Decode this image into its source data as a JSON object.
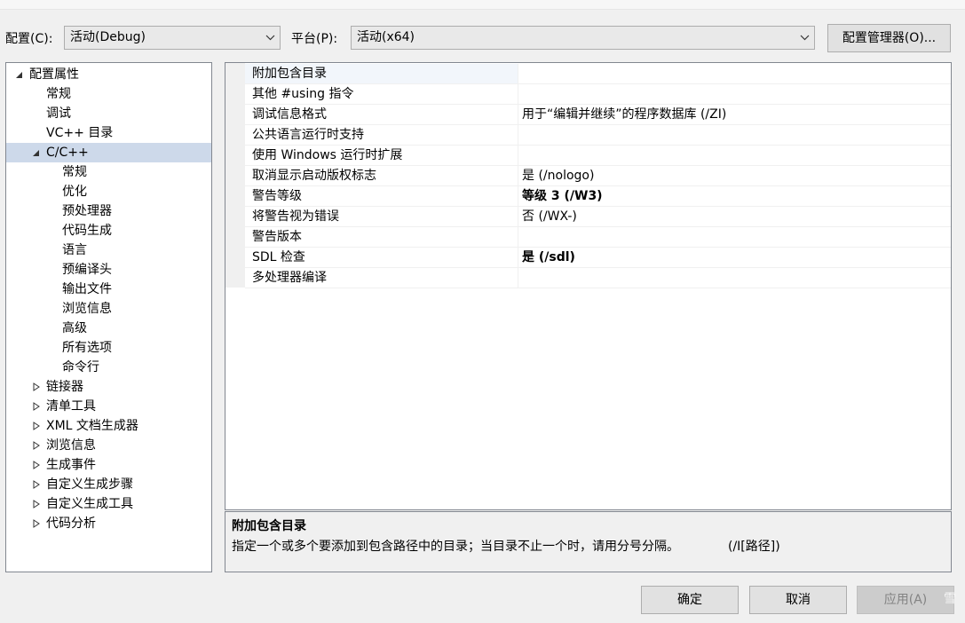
{
  "config": {
    "config_label": "配置(C):",
    "config_value": "活动(Debug)",
    "platform_label": "平台(P):",
    "platform_value": "活动(x64)",
    "manager_button": "配置管理器(O)..."
  },
  "tree": {
    "root": "配置属性",
    "general": "常规",
    "debugging": "调试",
    "vc_dirs": "VC++ 目录",
    "cpp": "C/C++",
    "cpp_children": [
      "常规",
      "优化",
      "预处理器",
      "代码生成",
      "语言",
      "预编译头",
      "输出文件",
      "浏览信息",
      "高级",
      "所有选项",
      "命令行"
    ],
    "collapsed": [
      "链接器",
      "清单工具",
      "XML 文档生成器",
      "浏览信息",
      "生成事件",
      "自定义生成步骤",
      "自定义生成工具",
      "代码分析"
    ]
  },
  "properties": [
    {
      "name": "附加包含目录",
      "value": "",
      "bold": false
    },
    {
      "name": "其他 #using 指令",
      "value": "",
      "bold": false
    },
    {
      "name": "调试信息格式",
      "value": "用于“编辑并继续”的程序数据库 (/ZI)",
      "bold": false
    },
    {
      "name": "公共语言运行时支持",
      "value": "",
      "bold": false
    },
    {
      "name": "使用 Windows 运行时扩展",
      "value": "",
      "bold": false
    },
    {
      "name": "取消显示启动版权标志",
      "value": "是 (/nologo)",
      "bold": false
    },
    {
      "name": "警告等级",
      "value": "等级 3 (/W3)",
      "bold": true
    },
    {
      "name": "将警告视为错误",
      "value": "否 (/WX-)",
      "bold": false
    },
    {
      "name": "警告版本",
      "value": "",
      "bold": false
    },
    {
      "name": "SDL 检查",
      "value": "是 (/sdl)",
      "bold": true
    },
    {
      "name": "多处理器编译",
      "value": "",
      "bold": false
    }
  ],
  "description": {
    "title": "附加包含目录",
    "text": "指定一个或多个要添加到包含路径中的目录；当目录不止一个时，请用分号分隔。",
    "flag": "(/I[路径])"
  },
  "buttons": {
    "ok": "确定",
    "cancel": "取消",
    "apply": "应用(A)"
  },
  "watermark": "雪"
}
